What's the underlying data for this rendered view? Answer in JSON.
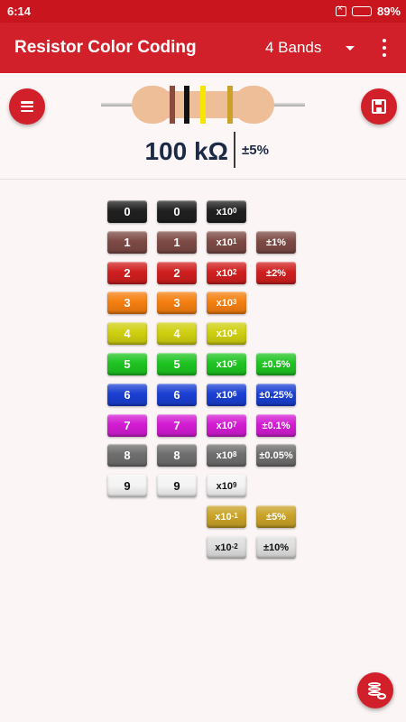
{
  "status": {
    "time": "6:14",
    "battery": "89%"
  },
  "toolbar": {
    "title": "Resistor Color Coding",
    "band_mode": "4 Bands"
  },
  "result": {
    "value": "100 kΩ",
    "tolerance": "±5%"
  },
  "resistor_bands": [
    "#8b4a3c",
    "#111111",
    "#f7e600",
    "#c9a227"
  ],
  "grid": {
    "rows": [
      {
        "color": "#202020",
        "text": "#ffffff",
        "d1": "0",
        "d2": "0",
        "mult_base": "x10",
        "mult_exp": "0",
        "tol": ""
      },
      {
        "color": "#7d4a45",
        "text": "#ffffff",
        "d1": "1",
        "d2": "1",
        "mult_base": "x10",
        "mult_exp": "1",
        "tol": "±1%"
      },
      {
        "color": "#d01f1f",
        "text": "#ffffff",
        "d1": "2",
        "d2": "2",
        "mult_base": "x10",
        "mult_exp": "2",
        "tol": "±2%"
      },
      {
        "color": "#f57f10",
        "text": "#ffffff",
        "d1": "3",
        "d2": "3",
        "mult_base": "x10",
        "mult_exp": "3",
        "tol": ""
      },
      {
        "color": "#cfcf10",
        "text": "#ffffff",
        "d1": "4",
        "d2": "4",
        "mult_base": "x10",
        "mult_exp": "4",
        "tol": ""
      },
      {
        "color": "#1ec421",
        "text": "#ffffff",
        "d1": "5",
        "d2": "5",
        "mult_base": "x10",
        "mult_exp": "5",
        "tol": "±0.5%"
      },
      {
        "color": "#1a3fd2",
        "text": "#ffffff",
        "d1": "6",
        "d2": "6",
        "mult_base": "x10",
        "mult_exp": "6",
        "tol": "±0.25%"
      },
      {
        "color": "#d21bd2",
        "text": "#ffffff",
        "d1": "7",
        "d2": "7",
        "mult_base": "x10",
        "mult_exp": "7",
        "tol": "±0.1%"
      },
      {
        "color": "#6e6e6e",
        "text": "#ffffff",
        "d1": "8",
        "d2": "8",
        "mult_base": "x10",
        "mult_exp": "8",
        "tol": "±0.05%"
      },
      {
        "color": "#f4f4f4",
        "text": "#111111",
        "d1": "9",
        "d2": "9",
        "mult_base": "x10",
        "mult_exp": "9",
        "tol": ""
      },
      {
        "color": "#c9a227",
        "text": "#ffffff",
        "d1": "",
        "d2": "",
        "mult_base": "x10",
        "mult_exp": "-1",
        "tol": "±5%"
      },
      {
        "color": "#dedede",
        "text": "#111111",
        "d1": "",
        "d2": "",
        "mult_base": "x10",
        "mult_exp": "-2",
        "tol": "±10%"
      }
    ]
  }
}
